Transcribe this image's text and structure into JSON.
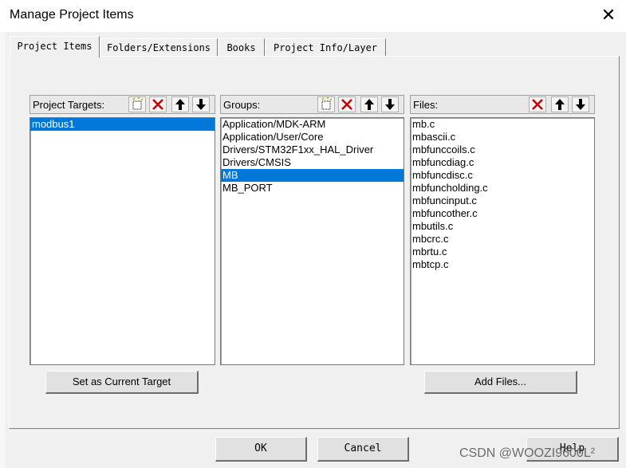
{
  "window": {
    "title": "Manage Project Items",
    "close_glyph": "✕"
  },
  "tabs": [
    {
      "label": "Project Items",
      "active": true
    },
    {
      "label": "Folders/Extensions",
      "active": false
    },
    {
      "label": "Books",
      "active": false
    },
    {
      "label": "Project Info/Layer",
      "active": false
    }
  ],
  "targets": {
    "label": "Project Targets:",
    "items": [
      "modbus1"
    ],
    "selected_index": 0,
    "set_current_label": "Set as Current Target"
  },
  "groups": {
    "label": "Groups:",
    "items": [
      "Application/MDK-ARM",
      "Application/User/Core",
      "Drivers/STM32F1xx_HAL_Driver",
      "Drivers/CMSIS",
      "MB",
      "MB_PORT"
    ],
    "selected_index": 4
  },
  "files": {
    "label": "Files:",
    "items": [
      "mb.c",
      "mbascii.c",
      "mbfunccoils.c",
      "mbfuncdiag.c",
      "mbfuncdisc.c",
      "mbfuncholding.c",
      "mbfuncinput.c",
      "mbfuncother.c",
      "mbutils.c",
      "mbcrc.c",
      "mbrtu.c",
      "mbtcp.c"
    ],
    "add_files_label": "Add Files..."
  },
  "toolbar_icons": {
    "new": "new-item-icon",
    "delete": "delete-icon",
    "up": "move-up-icon",
    "down": "move-down-icon"
  },
  "colors": {
    "selection": "#0078d7",
    "delete_icon": "#cc0000"
  },
  "footer": {
    "ok_label": "OK",
    "cancel_label": "Cancel",
    "help_label": "Help"
  },
  "watermark": "CSDN @WOOZI9600L²"
}
